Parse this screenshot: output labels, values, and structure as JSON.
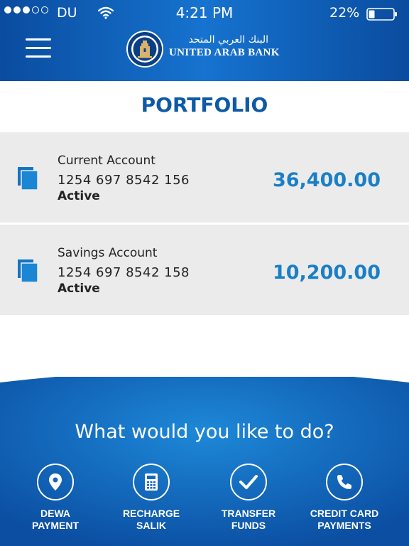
{
  "status_bar": {
    "carrier": "DU",
    "time": "4:21 PM",
    "battery": "22%",
    "signal_dots_filled": 3,
    "signal_dots_total": 5
  },
  "header": {
    "menu_icon": "hamburger-menu-icon",
    "logo": {
      "arabic": "البنك العربي المتحد",
      "english": "UNITED ARAB BANK"
    }
  },
  "portfolio": {
    "title": "PORTFOLIO",
    "accounts": [
      {
        "name": "Current Account",
        "number": "1254 697 8542 156",
        "status": "Active",
        "balance": "36,400.00"
      },
      {
        "name": "Savings Account",
        "number": "1254 697 8542 158",
        "status": "Active",
        "balance": "10,200.00"
      }
    ]
  },
  "actions": {
    "question": "What would you like to do?",
    "items": [
      {
        "line1": "DEWA",
        "line2": "PAYMENT",
        "icon": "location-pin-icon"
      },
      {
        "line1": "RECHARGE",
        "line2": "SALIK",
        "icon": "calculator-icon"
      },
      {
        "line1": "TRANSFER",
        "line2": "FUNDS",
        "icon": "checkmark-icon"
      },
      {
        "line1": "CREDIT CARD",
        "line2": "PAYMENTS",
        "icon": "phone-icon"
      }
    ]
  },
  "colors": {
    "primary_blue": "#0f5aa6",
    "balance_blue": "#1a7fc8",
    "card_gray": "#ebebeb"
  }
}
